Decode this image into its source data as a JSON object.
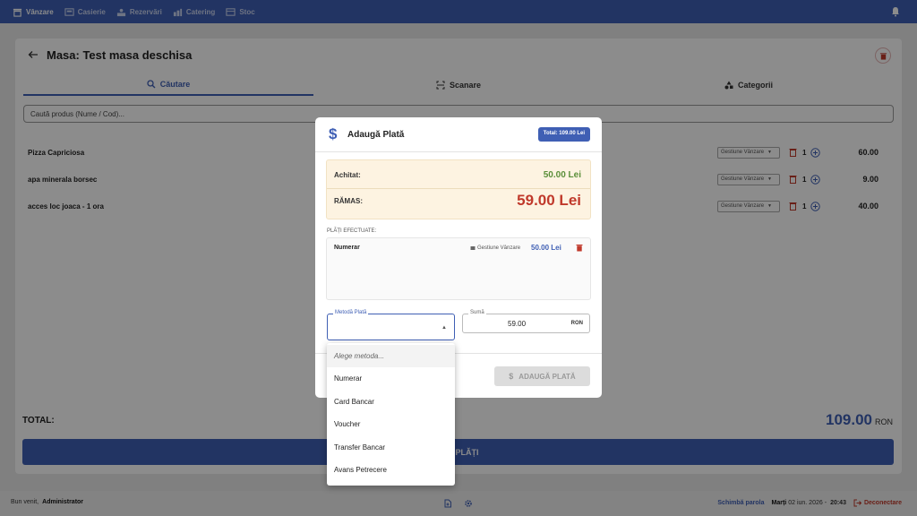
{
  "nav": {
    "items": [
      {
        "label": "Vânzare",
        "icon": "store-icon"
      },
      {
        "label": "Casierie",
        "icon": "cash-register-icon"
      },
      {
        "label": "Rezervări",
        "icon": "reservation-icon"
      },
      {
        "label": "Catering",
        "icon": "catering-icon"
      },
      {
        "label": "Stoc",
        "icon": "stock-icon"
      }
    ],
    "bell_icon": "bell-icon"
  },
  "main": {
    "title": "Masa: Test masa deschisa",
    "tabs": [
      {
        "label": "Căutare",
        "icon": "search-icon"
      },
      {
        "label": "Scanare",
        "icon": "scan-icon"
      },
      {
        "label": "Categorii",
        "icon": "categories-icon"
      }
    ],
    "search_placeholder": "Caută produs (Nume / Cod)...",
    "products": [
      {
        "name": "Pizza Capriciosa",
        "dept": "Gestiune Vânzare",
        "qty": "1",
        "price": "60.00"
      },
      {
        "name": "apa minerala borsec",
        "dept": "Gestiune Vânzare",
        "qty": "1",
        "price": "9.00"
      },
      {
        "name": "acces loc joaca - 1 ora",
        "dept": "Gestiune Vânzare",
        "qty": "1",
        "price": "40.00"
      }
    ],
    "total_label": "TOTAL:",
    "total_value": "109.00",
    "total_currency": "RON",
    "pay_button": "RE / PLĂȚI"
  },
  "footer": {
    "welcome": "Bun venit,",
    "user": "Administrator",
    "change_password": "Schimbă parola",
    "day": "Marți",
    "date": "02 iun. 2026",
    "separator": "-",
    "time": "20:43",
    "logout": "Deconectare"
  },
  "modal": {
    "title": "Adaugă Plată",
    "badge": "Total: 109.00 Lei",
    "paid_label": "Achitat:",
    "paid_value": "50.00 Lei",
    "remaining_label": "RĂMAS:",
    "remaining_value": "59.00 Lei",
    "payments_label": "PLĂȚI EFECTUATE:",
    "payments": [
      {
        "method": "Numerar",
        "source": "Gestiune Vânzare",
        "amount": "50.00 Lei"
      }
    ],
    "method_label": "Metodă Plată",
    "amount_label": "Sumă",
    "amount_value": "59.00",
    "amount_currency": "RON",
    "add_button": "ADAUGĂ PLATĂ"
  },
  "dropdown": {
    "placeholder": "Alege metoda...",
    "options": [
      "Numerar",
      "Card Bancar",
      "Voucher",
      "Transfer Bancar",
      "Avans Petrecere"
    ]
  },
  "colors": {
    "primary": "#3f5fb4",
    "danger": "#c0392b",
    "success": "#5b8f3a"
  }
}
